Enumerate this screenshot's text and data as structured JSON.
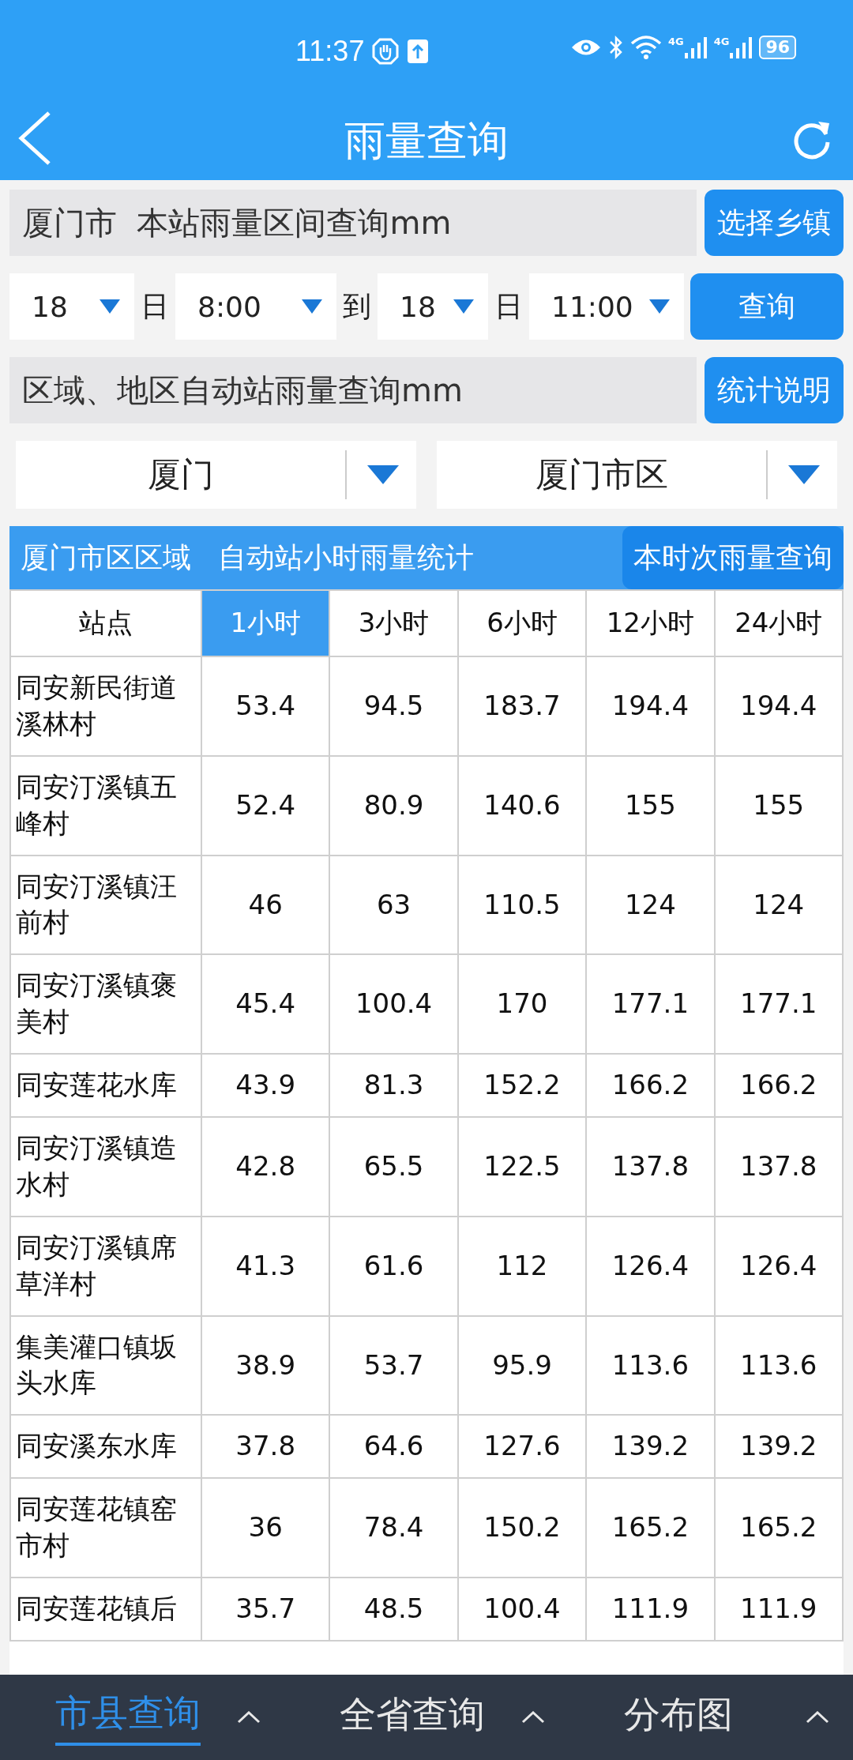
{
  "status_bar": {
    "time": "11:37",
    "signal_labels": [
      "4G",
      "4G"
    ],
    "battery": "96"
  },
  "header": {
    "title": "雨量查询"
  },
  "station_query": {
    "label": "厦门市  本站雨量区间查询mm",
    "button": "选择乡镇"
  },
  "time_range": [
    {
      "kind": "select",
      "value": "18"
    },
    {
      "kind": "label",
      "text": "日"
    },
    {
      "kind": "select",
      "value": "8:00"
    },
    {
      "kind": "label",
      "text": "到"
    },
    {
      "kind": "select",
      "value": "18"
    },
    {
      "kind": "label",
      "text": "日"
    },
    {
      "kind": "select",
      "value": "11:00"
    },
    {
      "kind": "button",
      "text": "查询"
    }
  ],
  "area_query": {
    "label": "区域、地区自动站雨量查询mm",
    "button": "统计说明"
  },
  "area_selects": [
    {
      "value": "厦门"
    },
    {
      "value": "厦门市区"
    }
  ],
  "stats_bar": {
    "title": "厦门市区区域   自动站小时雨量统计",
    "button": "本时次雨量查询"
  },
  "table": {
    "columns": [
      {
        "label": "站点",
        "selected": false
      },
      {
        "label": "1小时",
        "selected": true
      },
      {
        "label": "3小时",
        "selected": false
      },
      {
        "label": "6小时",
        "selected": false
      },
      {
        "label": "12小时",
        "selected": false
      },
      {
        "label": "24小时",
        "selected": false
      }
    ],
    "rows": [
      [
        "同安新民街道溪林村",
        "53.4",
        "94.5",
        "183.7",
        "194.4",
        "194.4"
      ],
      [
        "同安汀溪镇五峰村",
        "52.4",
        "80.9",
        "140.6",
        "155",
        "155"
      ],
      [
        "同安汀溪镇汪前村",
        "46",
        "63",
        "110.5",
        "124",
        "124"
      ],
      [
        "同安汀溪镇褒美村",
        "45.4",
        "100.4",
        "170",
        "177.1",
        "177.1"
      ],
      [
        "同安莲花水库",
        "43.9",
        "81.3",
        "152.2",
        "166.2",
        "166.2"
      ],
      [
        "同安汀溪镇造水村",
        "42.8",
        "65.5",
        "122.5",
        "137.8",
        "137.8"
      ],
      [
        "同安汀溪镇席草洋村",
        "41.3",
        "61.6",
        "112",
        "126.4",
        "126.4"
      ],
      [
        "集美灌口镇坂头水库",
        "38.9",
        "53.7",
        "95.9",
        "113.6",
        "113.6"
      ],
      [
        "同安溪东水库",
        "37.8",
        "64.6",
        "127.6",
        "139.2",
        "139.2"
      ],
      [
        "同安莲花镇窑市村",
        "36",
        "78.4",
        "150.2",
        "165.2",
        "165.2"
      ],
      [
        "同安莲花镇后",
        "35.7",
        "48.5",
        "100.4",
        "111.9",
        "111.9"
      ]
    ]
  },
  "bottom_tabs": [
    {
      "label": "市县查询",
      "selected": true
    },
    {
      "label": "全省查询",
      "selected": false
    },
    {
      "label": "分布图",
      "selected": false
    }
  ]
}
